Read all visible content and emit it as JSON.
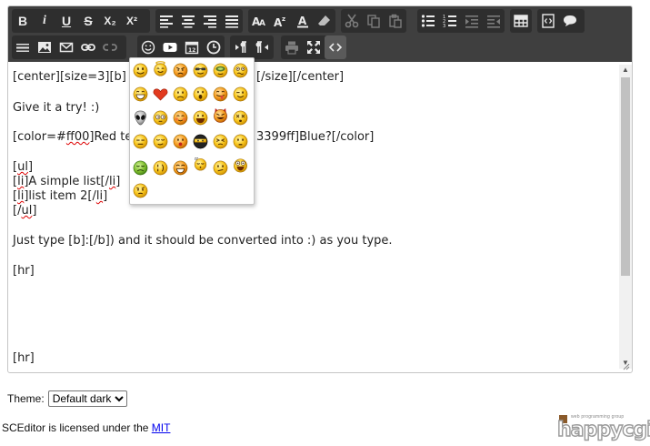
{
  "editor": {
    "toolbar_row1": [
      {
        "name": "bold-icon",
        "label": "B"
      },
      {
        "name": "italic-icon",
        "label": "i"
      },
      {
        "name": "underline-icon",
        "label": "U"
      },
      {
        "name": "strikethrough-icon",
        "label": "S"
      },
      {
        "name": "subscript-icon",
        "label": "X₂"
      },
      {
        "name": "superscript-icon",
        "label": "X²"
      },
      {
        "name": "align-left-icon"
      },
      {
        "name": "align-center-icon"
      },
      {
        "name": "align-right-icon"
      },
      {
        "name": "justify-icon"
      },
      {
        "name": "font-name-icon"
      },
      {
        "name": "font-size-icon"
      },
      {
        "name": "font-color-icon"
      },
      {
        "name": "remove-format-icon"
      },
      {
        "name": "cut-icon"
      },
      {
        "name": "copy-icon"
      },
      {
        "name": "paste-icon"
      },
      {
        "name": "bullet-list-icon"
      },
      {
        "name": "ordered-list-icon"
      },
      {
        "name": "indent-icon"
      },
      {
        "name": "outdent-icon"
      },
      {
        "name": "table-icon"
      },
      {
        "name": "code-icon"
      },
      {
        "name": "quote-icon"
      }
    ],
    "toolbar_row2": [
      {
        "name": "horizontal-rule-icon"
      },
      {
        "name": "image-icon"
      },
      {
        "name": "email-icon"
      },
      {
        "name": "link-icon"
      },
      {
        "name": "unlink-icon"
      },
      {
        "name": "emoticon-icon"
      },
      {
        "name": "youtube-icon"
      },
      {
        "name": "date-icon"
      },
      {
        "name": "time-icon"
      },
      {
        "name": "ltr-icon"
      },
      {
        "name": "rtl-icon"
      },
      {
        "name": "print-icon"
      },
      {
        "name": "maximize-icon"
      },
      {
        "name": "source-mode-icon"
      }
    ],
    "content_lines": [
      "[center][size=3][b]",
      "[/size][/center]",
      "Give it a try! :)",
      "[color=#ff00]Red te",
      "3399ff]Blue?[/color]",
      "[ul]",
      "[li]A simple list[/li]",
      "[li]list item 2[/li]",
      "[/ul]",
      "Just type [b]:[/b]) and it should be converted into :) as you type.",
      "[hr]",
      "[hr]"
    ],
    "emoticons": [
      "smile",
      "angel",
      "angry",
      "cool",
      "alien-face",
      "confused",
      "grin",
      "heart",
      "sad",
      "shocked",
      "tongue",
      "wink",
      "alien",
      "blink",
      "blush",
      "cheerful",
      "devil",
      "dizzy",
      "ermm",
      "getlost",
      "happy",
      "ninja",
      "pinch",
      "pouty",
      "sick",
      "sideways",
      "silly",
      "sleeping",
      "unsure",
      "woot",
      "wassat"
    ]
  },
  "theme": {
    "label": "Theme:",
    "selected": "Default dark"
  },
  "footer": {
    "text": "SCEditor is licensed under the ",
    "link": "MIT"
  },
  "logo": {
    "tagline": "web programming group",
    "word": "happycgi"
  }
}
